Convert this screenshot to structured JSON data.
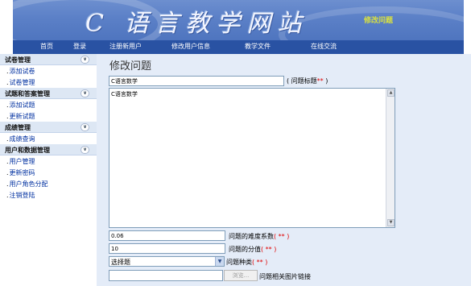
{
  "header": {
    "site_title": "C 语言教学网站",
    "site_subtitle": "修改问题"
  },
  "nav": {
    "items": [
      "首页",
      "登录",
      "注册新用户",
      "修改用户信息",
      "教学文件",
      "在线交流"
    ]
  },
  "sidebar": {
    "sections": [
      {
        "title": "试卷管理",
        "toggle": "∨",
        "links": [
          "添加试卷",
          "试卷管理"
        ]
      },
      {
        "title": "试题和答案管理",
        "toggle": "∨",
        "links": [
          "添加试题",
          "更新试题"
        ]
      },
      {
        "title": "成绩管理",
        "toggle": "∨",
        "links": [
          "成绩查询"
        ]
      },
      {
        "title": "用户和数据管理",
        "toggle": "∨",
        "links": [
          "用户管理",
          "更新密码",
          "用户角色分配",
          "注销登陆"
        ]
      }
    ]
  },
  "form": {
    "page_title": "修改问题",
    "title_value": "C语言数学",
    "title_label": "( 问题标题",
    "title_req": "**",
    "title_label_end": " )",
    "content_value": "C语言数学",
    "difficulty_value": "0.06",
    "difficulty_label": "问题的难度系数",
    "difficulty_req": "( ** )",
    "score_value": "10",
    "score_label": "问题的分值",
    "score_req": "( ** )",
    "type_value": "选择题",
    "type_label": "问题种类",
    "type_req": "( ** )",
    "browse_label": "浏览...",
    "image_label": "问题相关图片链接"
  }
}
